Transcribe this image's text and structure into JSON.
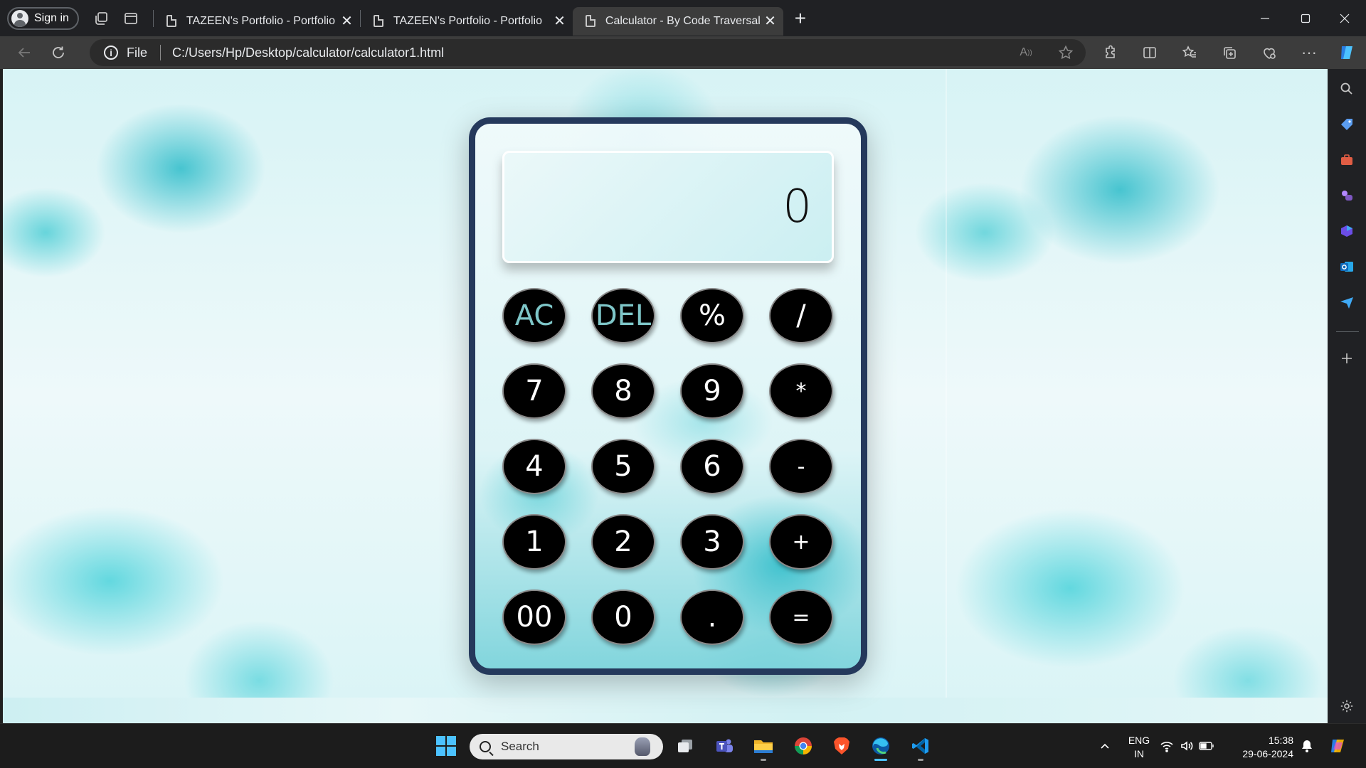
{
  "browser": {
    "sign_in_label": "Sign in",
    "tabs": [
      {
        "title": "TAZEEN's Portfolio - Portfolio",
        "active": false
      },
      {
        "title": "TAZEEN's Portfolio - Portfolio",
        "active": false
      },
      {
        "title": "Calculator - By Code Traversal",
        "active": true
      }
    ],
    "new_tab_symbol": "+",
    "close_symbol": "✕",
    "address": {
      "scheme_label": "File",
      "url": "C:/Users/Hp/Desktop/calculator/calculator1.html"
    }
  },
  "calculator": {
    "display_value": "0",
    "keys": [
      {
        "label": "AC",
        "kind": "fn"
      },
      {
        "label": "DEL",
        "kind": "fn"
      },
      {
        "label": "%",
        "kind": "op"
      },
      {
        "label": "/",
        "kind": "op"
      },
      {
        "label": "7",
        "kind": "num"
      },
      {
        "label": "8",
        "kind": "num"
      },
      {
        "label": "9",
        "kind": "num"
      },
      {
        "label": "*",
        "kind": "op"
      },
      {
        "label": "4",
        "kind": "num"
      },
      {
        "label": "5",
        "kind": "num"
      },
      {
        "label": "6",
        "kind": "num"
      },
      {
        "label": "-",
        "kind": "op"
      },
      {
        "label": "1",
        "kind": "num"
      },
      {
        "label": "2",
        "kind": "num"
      },
      {
        "label": "3",
        "kind": "num"
      },
      {
        "label": "+",
        "kind": "op"
      },
      {
        "label": "00",
        "kind": "num"
      },
      {
        "label": "0",
        "kind": "num"
      },
      {
        "label": ".",
        "kind": "num"
      },
      {
        "label": "=",
        "kind": "op"
      }
    ]
  },
  "taskbar": {
    "search_placeholder": "Search",
    "language_line1": "ENG",
    "language_line2": "IN",
    "time": "15:38",
    "date": "29-06-2024",
    "apps": [
      "start-icon",
      "task-view-icon",
      "teams-icon",
      "file-explorer-icon",
      "chrome-icon",
      "brave-icon",
      "edge-icon",
      "vscode-icon"
    ]
  },
  "colors": {
    "calculator_frame": "#25395c",
    "key_background": "#000000",
    "function_key_text": "#7ec6c8",
    "accent": "#4cc2ff"
  }
}
